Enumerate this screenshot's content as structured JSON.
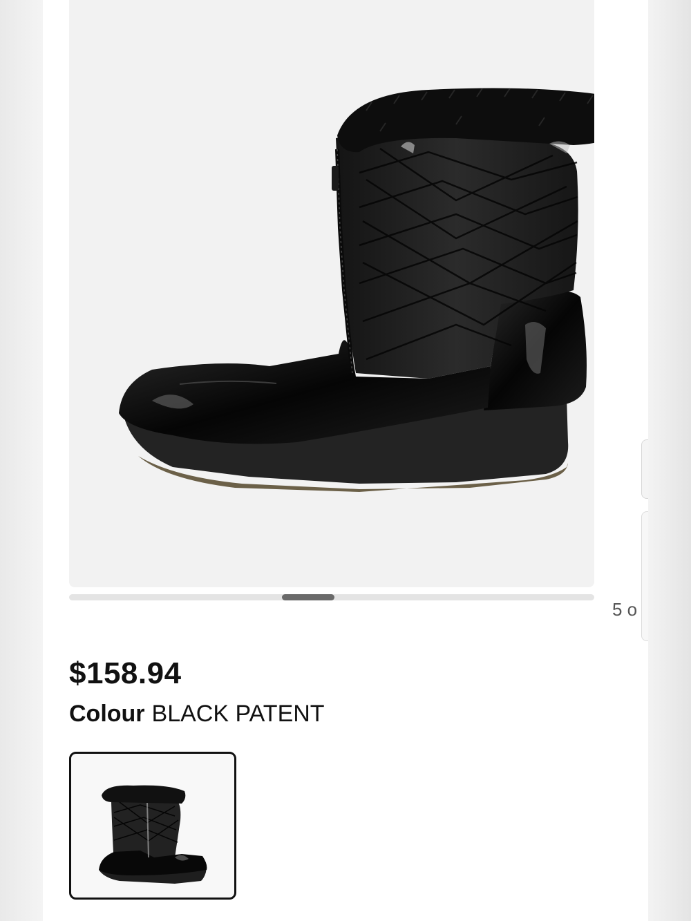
{
  "product": {
    "price": "$158.94",
    "colour_label": "Colour",
    "colour_value": "BLACK PATENT"
  },
  "gallery": {
    "counter": "5 o",
    "scroll_position_fraction": 0.45,
    "image_icon": "black-winter-boot-image"
  },
  "swatches": [
    {
      "icon": "black-winter-boot-thumbnail",
      "selected": true
    }
  ]
}
